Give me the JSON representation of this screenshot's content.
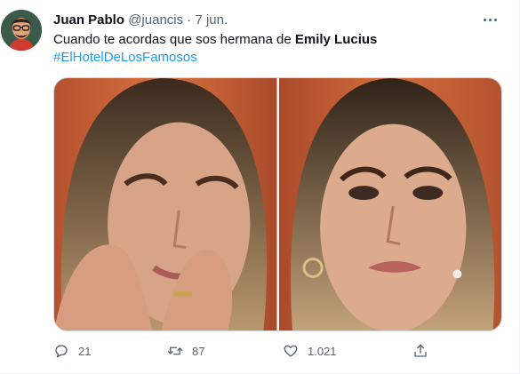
{
  "tweet": {
    "author_name": "Juan Pablo",
    "handle": "@juancis",
    "separator": "·",
    "date": "7 jun.",
    "text_prefix": "Cuando te acordas que sos hermana de ",
    "text_bold": "Emily Lucius",
    "hashtag": "#ElHotelDeLosFamosos",
    "reply_count": "21",
    "retweet_count": "87",
    "like_count": "1.021"
  },
  "colors": {
    "link": "#1d9bf0",
    "secondary_text": "#536471"
  },
  "icons": [
    "more-icon",
    "reply-icon",
    "retweet-icon",
    "like-icon",
    "share-icon"
  ]
}
